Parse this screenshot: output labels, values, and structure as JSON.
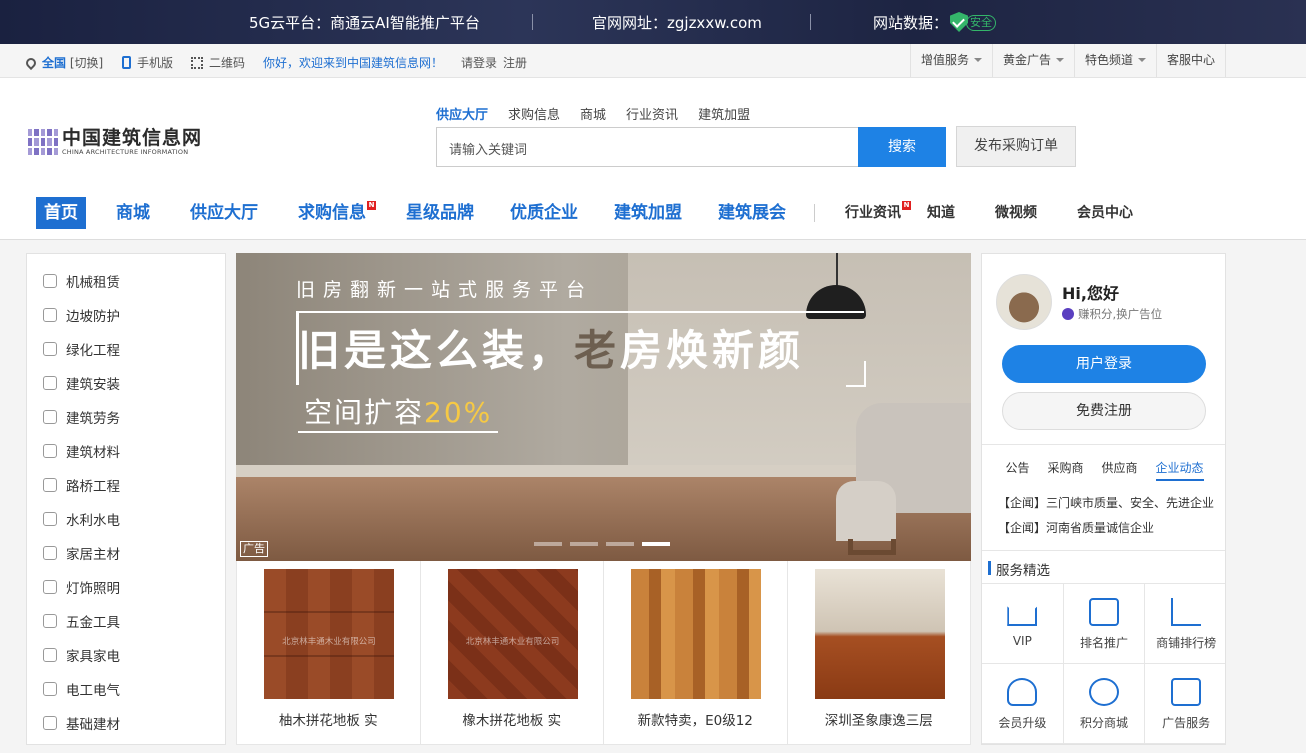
{
  "top_banner": {
    "platform": "5G云平台：商通云AI智能推广平台",
    "website": "官网网址：zgjzxxw.com",
    "data_label": "网站数据：",
    "safe": "安全"
  },
  "util_bar": {
    "region": "全国",
    "switch": "[切换]",
    "mobile": "手机版",
    "qrcode": "二维码",
    "welcome": "你好，欢迎来到中国建筑信息网！",
    "login": "请登录",
    "register": "注册",
    "menus": [
      "增值服务",
      "黄金广告",
      "特色频道",
      "客服中心"
    ]
  },
  "logo": {
    "cn": "中国建筑信息网",
    "en": "CHINA ARCHITECTURE INFORMATION"
  },
  "search": {
    "tabs": [
      "供应大厅",
      "求购信息",
      "商城",
      "行业资讯",
      "建筑加盟"
    ],
    "placeholder": "请输入关键词",
    "button": "搜索",
    "publish": "发布采购订单"
  },
  "main_nav": {
    "primary": [
      "首页",
      "商城",
      "供应大厅",
      "求购信息",
      "星级品牌",
      "优质企业",
      "建筑加盟",
      "建筑展会"
    ],
    "secondary": [
      "行业资讯",
      "知道",
      "微视频",
      "会员中心"
    ],
    "new_tag": "N"
  },
  "categories": [
    "机械租赁",
    "边坡防护",
    "绿化工程",
    "建筑安装",
    "建筑劳务",
    "建筑材料",
    "路桥工程",
    "水利水电",
    "家居主材",
    "灯饰照明",
    "五金工具",
    "家具家电",
    "电工电气",
    "基础建材"
  ],
  "banner": {
    "small": "旧房翻新一站式服务平台",
    "big_a": "旧是这么装，",
    "big_b": "老",
    "big_c": "房焕新颜",
    "sub": "空间扩容",
    "pct": "20%",
    "ad_tag": "广告"
  },
  "products": [
    {
      "name": "柚木拼花地板 实",
      "watermark": "北京林丰通木业有限公司"
    },
    {
      "name": "橡木拼花地板 实",
      "watermark": "北京林丰通木业有限公司"
    },
    {
      "name": "新款特卖，E0级12",
      "watermark": ""
    },
    {
      "name": "深圳圣象康逸三层",
      "watermark": ""
    }
  ],
  "right_panel": {
    "greeting": "Hi,您好",
    "earn": "赚积分,换广告位",
    "login_btn": "用户登录",
    "register_btn": "免费注册",
    "tabs": [
      "公告",
      "采购商",
      "供应商",
      "企业动态"
    ],
    "news": [
      "【企闻】三门峡市质量、安全、先进企业",
      "【企闻】河南省质量诚信企业"
    ],
    "service_title": "服务精选",
    "services": [
      "VIP",
      "排名推广",
      "商铺排行榜",
      "会员升级",
      "积分商城",
      "广告服务"
    ]
  },
  "colors": {
    "accent": "#1e82e5",
    "nav_blue": "#1e6fd1",
    "top_bg": "#1a2140",
    "safe_green": "#34b56a"
  }
}
